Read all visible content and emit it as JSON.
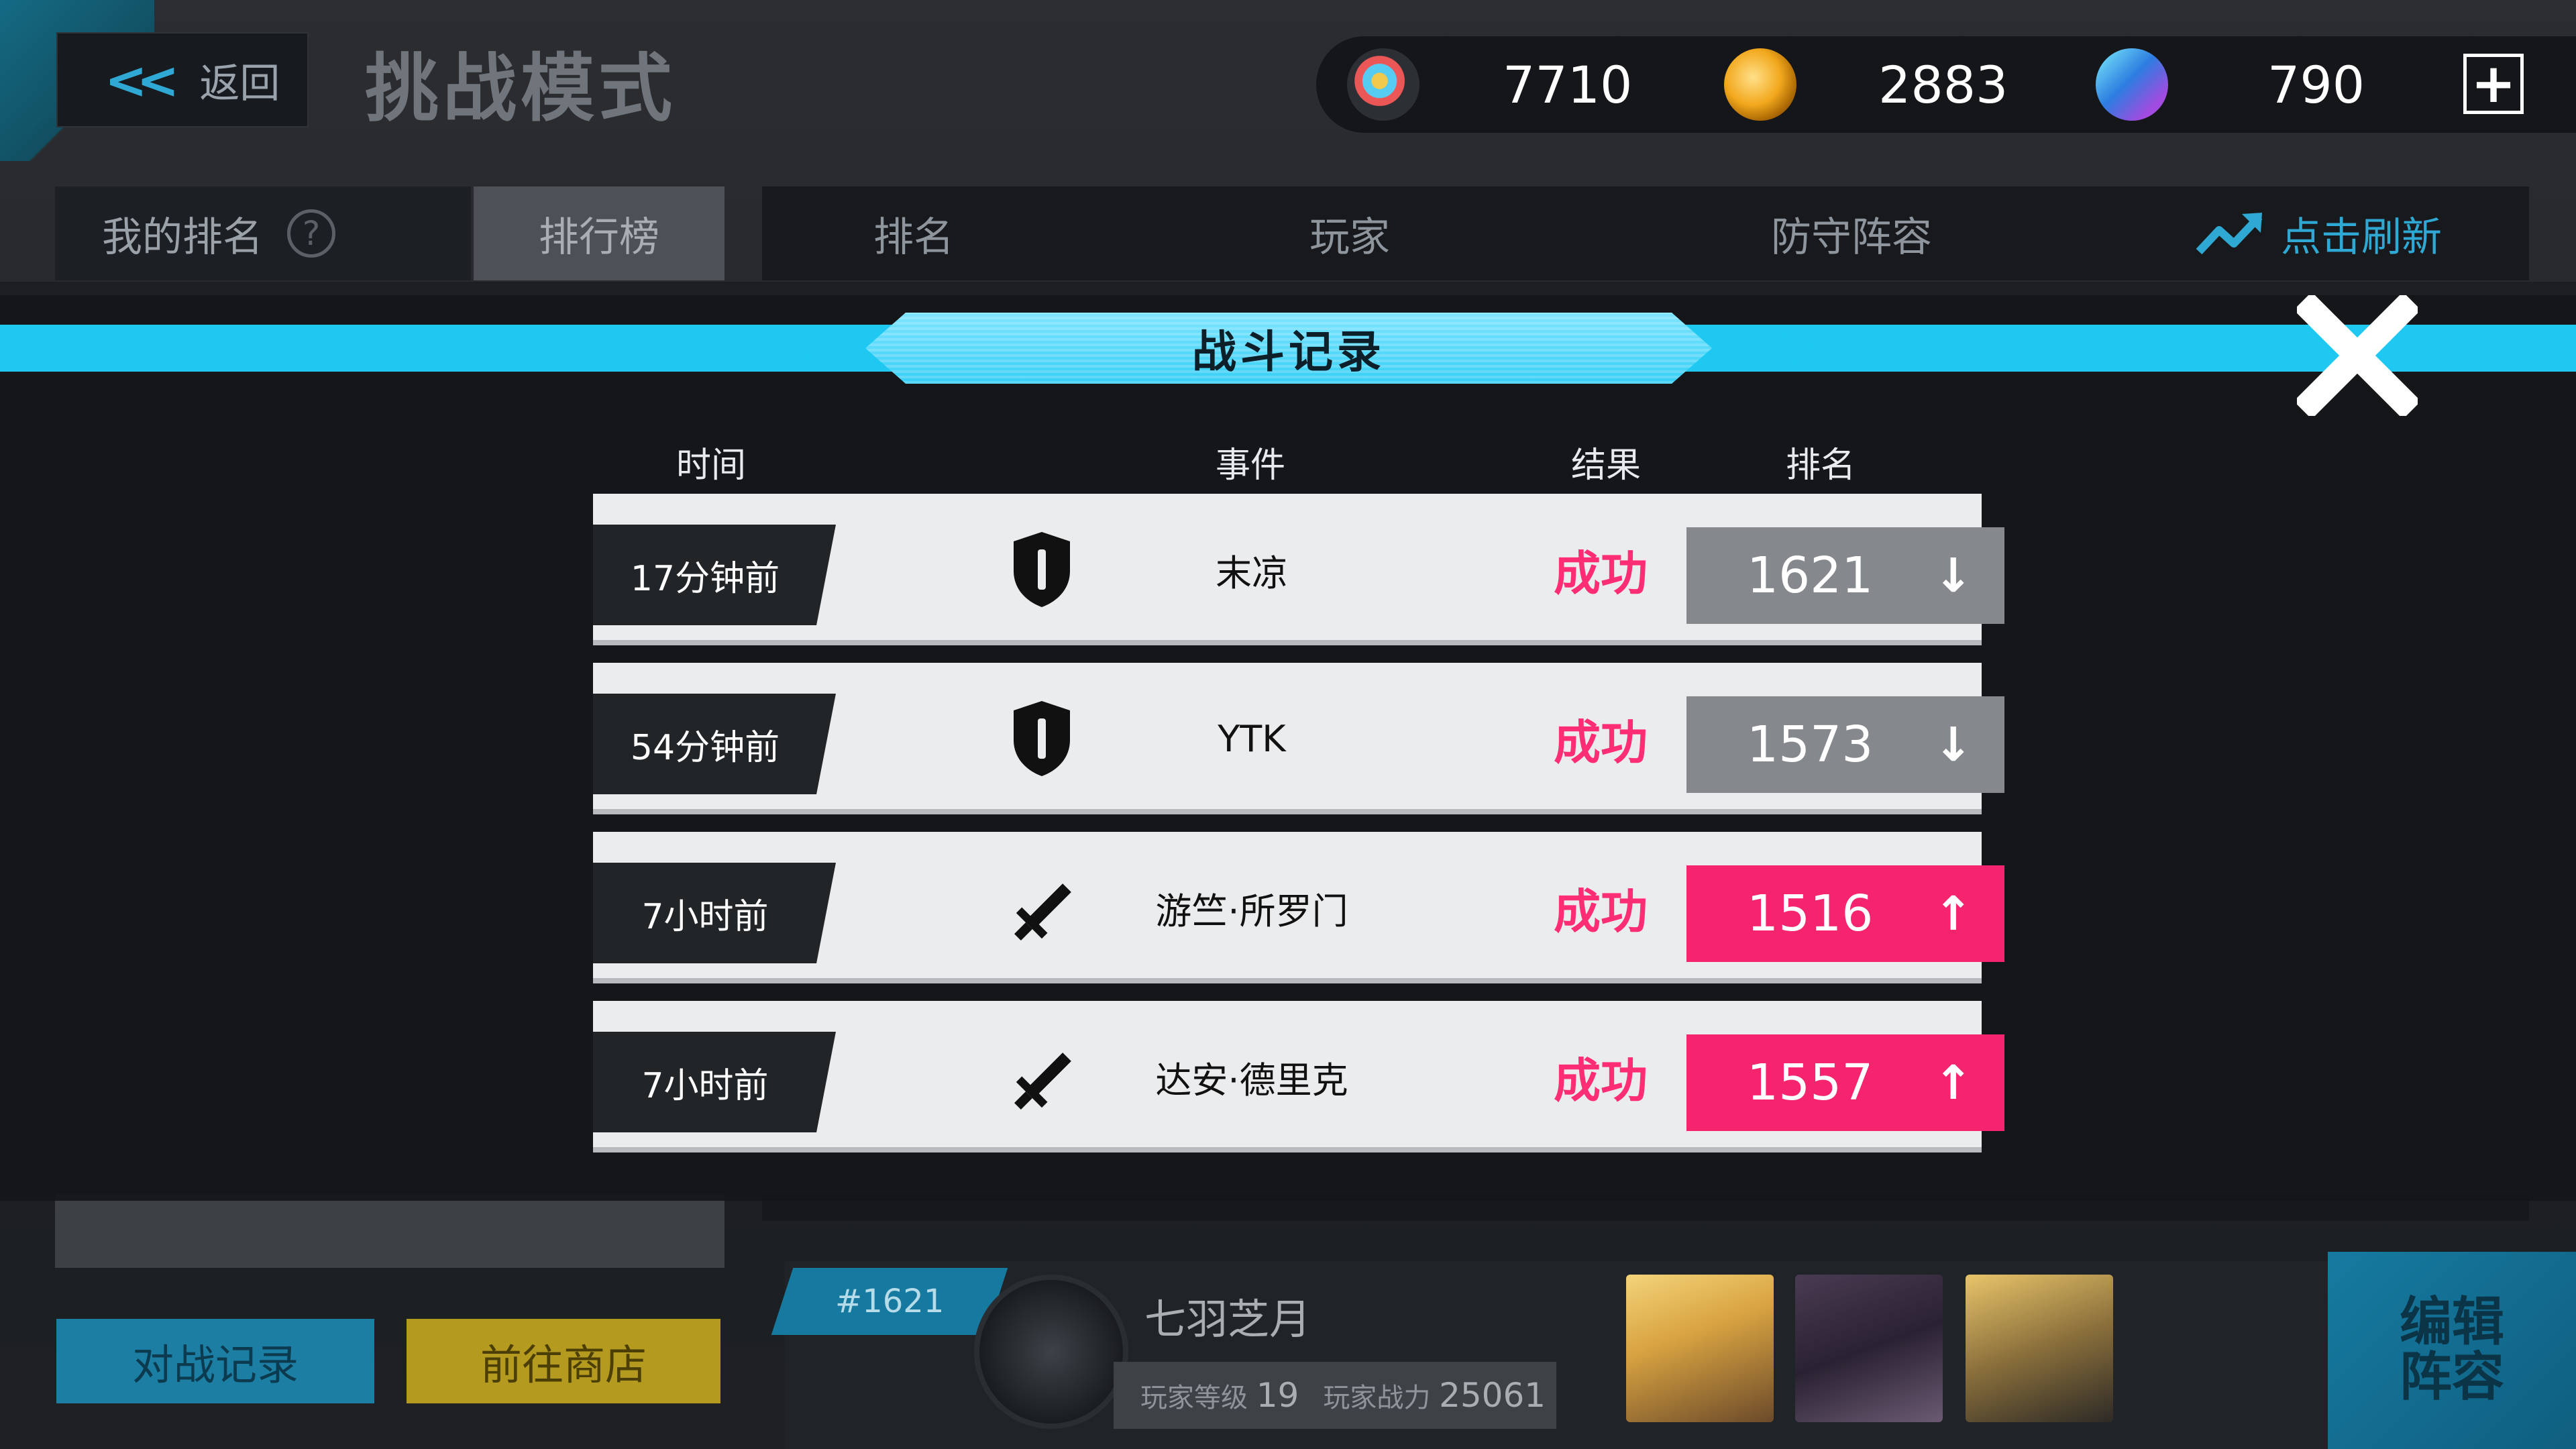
{
  "header": {
    "back_label": "返回",
    "title": "挑战模式"
  },
  "currencies": [
    {
      "icon": "rainbow-ticket-icon",
      "value": "7710"
    },
    {
      "icon": "gold-coin-icon",
      "value": "2883"
    },
    {
      "icon": "crystal-cube-icon",
      "value": "790"
    }
  ],
  "tabs": {
    "my_rank": "我的排名",
    "leaderboard": "排行榜"
  },
  "leaderboard_header": {
    "rank": "排名",
    "player": "玩家",
    "defense": "防守阵容",
    "refresh": "点击刷新"
  },
  "modal": {
    "title": "战斗记录",
    "columns": {
      "time": "时间",
      "event": "事件",
      "result": "结果",
      "rank": "排名"
    },
    "records": [
      {
        "time": "17分钟前",
        "event_icon": "shield-icon",
        "opponent": "末凉",
        "result": "成功",
        "rank": "1621",
        "direction": "down"
      },
      {
        "time": "54分钟前",
        "event_icon": "shield-icon",
        "opponent": "YTK",
        "result": "成功",
        "rank": "1573",
        "direction": "down"
      },
      {
        "time": "7小时前",
        "event_icon": "sword-icon",
        "opponent": "游竺·所罗门",
        "result": "成功",
        "rank": "1516",
        "direction": "up"
      },
      {
        "time": "7小时前",
        "event_icon": "sword-icon",
        "opponent": "达安·德里克",
        "result": "成功",
        "rank": "1557",
        "direction": "up"
      }
    ]
  },
  "bottom": {
    "battle_record_button": "对战记录",
    "shop_button": "前往商店",
    "player_rank_tag": "#1621",
    "player_name": "七羽芝月",
    "level_label": "玩家等级",
    "level_value": "19",
    "power_label": "玩家战力",
    "power_value": "25061",
    "edit_team_button": "编辑阵容"
  },
  "colors": {
    "accent_cyan": "#1ec8f0",
    "success_pink": "#ff2d74",
    "rank_up": "#f6246f",
    "rank_down": "#85888c"
  }
}
